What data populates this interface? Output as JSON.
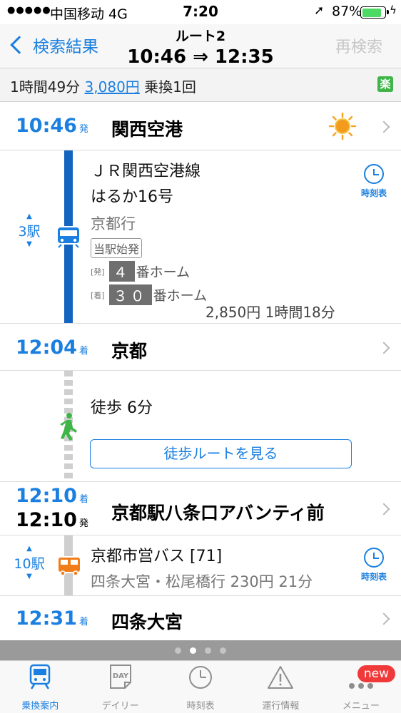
{
  "status_bar": {
    "signal": "●●●●●",
    "carrier": "中国移动   4G",
    "time": "7:20",
    "battery_pct": "87%",
    "battery_level": 0.87,
    "location_icon": "location-arrow-icon",
    "charging_icon": "bolt-icon"
  },
  "nav": {
    "back_label": "検索結果",
    "route_title": "ルート2",
    "route_times": "10:46 ⇒ 12:35",
    "research_label": "再検索"
  },
  "summary": {
    "duration": "1時間49分",
    "fare": "3,080円",
    "transfers": "乗換1回",
    "rakuten_icon": "楽"
  },
  "stations": [
    {
      "time": "10:46",
      "suffix": "発",
      "name": "関西空港",
      "weather_icon": "sun-icon"
    },
    {
      "time": "12:04",
      "suffix": "着",
      "name": "京都"
    },
    {
      "time_arr": "12:10",
      "suffix_arr": "着",
      "time_dep": "12:10",
      "suffix_dep": "発",
      "name": "京都駅八条口アバンティ前"
    },
    {
      "time": "12:31",
      "suffix": "着",
      "name": "四条大宮"
    }
  ],
  "train_segment": {
    "stops_count": "3駅",
    "line_name": "ＪＲ関西空港線",
    "train_name": "はるか16号",
    "direction": "京都行",
    "origin_badge": "当駅始発",
    "dep_label": "[発]",
    "dep_platform_num": "４",
    "dep_platform_suffix": "番ホーム",
    "arr_label": "[着]",
    "arr_platform_num": "３０",
    "arr_platform_suffix": "番ホーム",
    "fare_time": "2,850円  1時間18分",
    "timetable_label": "時刻表"
  },
  "walk_segment": {
    "text": "徒歩  6分",
    "button_label": "徒歩ルートを見る"
  },
  "bus_segment": {
    "stops_count": "10駅",
    "line_name": "京都市営バス [71]",
    "detail": "四条大宮・松尾橋行   230円  21分",
    "timetable_label": "時刻表"
  },
  "page_dots": {
    "count": 4,
    "active": 1
  },
  "tabbar": [
    {
      "label": "乗換案内",
      "icon": "train-icon",
      "active": true
    },
    {
      "label": "デイリー",
      "icon": "daily-calendar-icon",
      "active": false
    },
    {
      "label": "時刻表",
      "icon": "clock-icon",
      "active": false
    },
    {
      "label": "運行情報",
      "icon": "warning-icon",
      "active": false
    },
    {
      "label": "メニュー",
      "icon": "more-icon",
      "active": false,
      "badge": "new"
    }
  ],
  "colors": {
    "accent": "#1a7fe0",
    "jr_line": "#1565c0",
    "walk_green": "#3fb548",
    "bus_orange": "#f07d1a",
    "badge_red": "#f03a3a"
  }
}
